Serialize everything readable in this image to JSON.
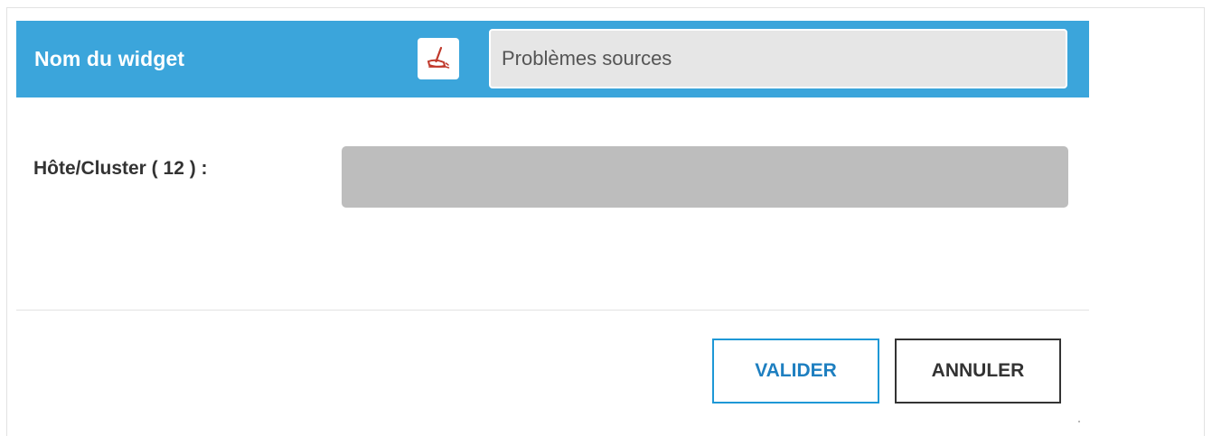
{
  "colors": {
    "header_bg": "#3ba5db",
    "validate_border": "#1e98d6",
    "cancel_border": "#333333",
    "select_bg": "#bdbdbd",
    "clear_icon": "#c0392b"
  },
  "header": {
    "title": "Nom du widget",
    "clear_icon": "broom-icon",
    "name_input": {
      "value": "",
      "placeholder": "Problèmes sources"
    }
  },
  "form": {
    "host_label": "Hôte/Cluster ( 12 ) :",
    "host_select": {
      "value": ""
    }
  },
  "footer": {
    "validate_label": "VALIDER",
    "cancel_label": "ANNULER"
  }
}
